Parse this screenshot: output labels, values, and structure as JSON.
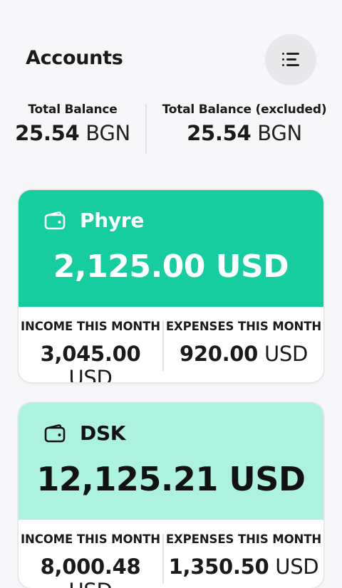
{
  "header": {
    "title": "Accounts",
    "menu_icon": "menu-icon"
  },
  "totals": {
    "balance": {
      "label": "Total Balance",
      "amount": "25.54",
      "currency": "BGN"
    },
    "excluded": {
      "label": "Total Balance (excluded)",
      "amount": "25.54",
      "currency": "BGN"
    }
  },
  "accounts": [
    {
      "name": "Phyre",
      "icon": "wallet-icon",
      "balance": "2,125.00 USD",
      "color": "#16cda0",
      "income": {
        "label": "INCOME THIS MONTH",
        "amount": "3,045.00",
        "currency": "USD"
      },
      "expenses": {
        "label": "EXPENSES THIS MONTH",
        "amount": "920.00",
        "currency": "USD"
      }
    },
    {
      "name": "DSK",
      "icon": "wallet-icon",
      "balance": "12,125.21 USD",
      "color": "#adf2df",
      "income": {
        "label": "INCOME THIS MONTH",
        "amount": "8,000.48",
        "currency": "USD"
      },
      "expenses": {
        "label": "EXPENSES THIS MONTH",
        "amount": "1,350.50",
        "currency": "USD"
      }
    }
  ]
}
